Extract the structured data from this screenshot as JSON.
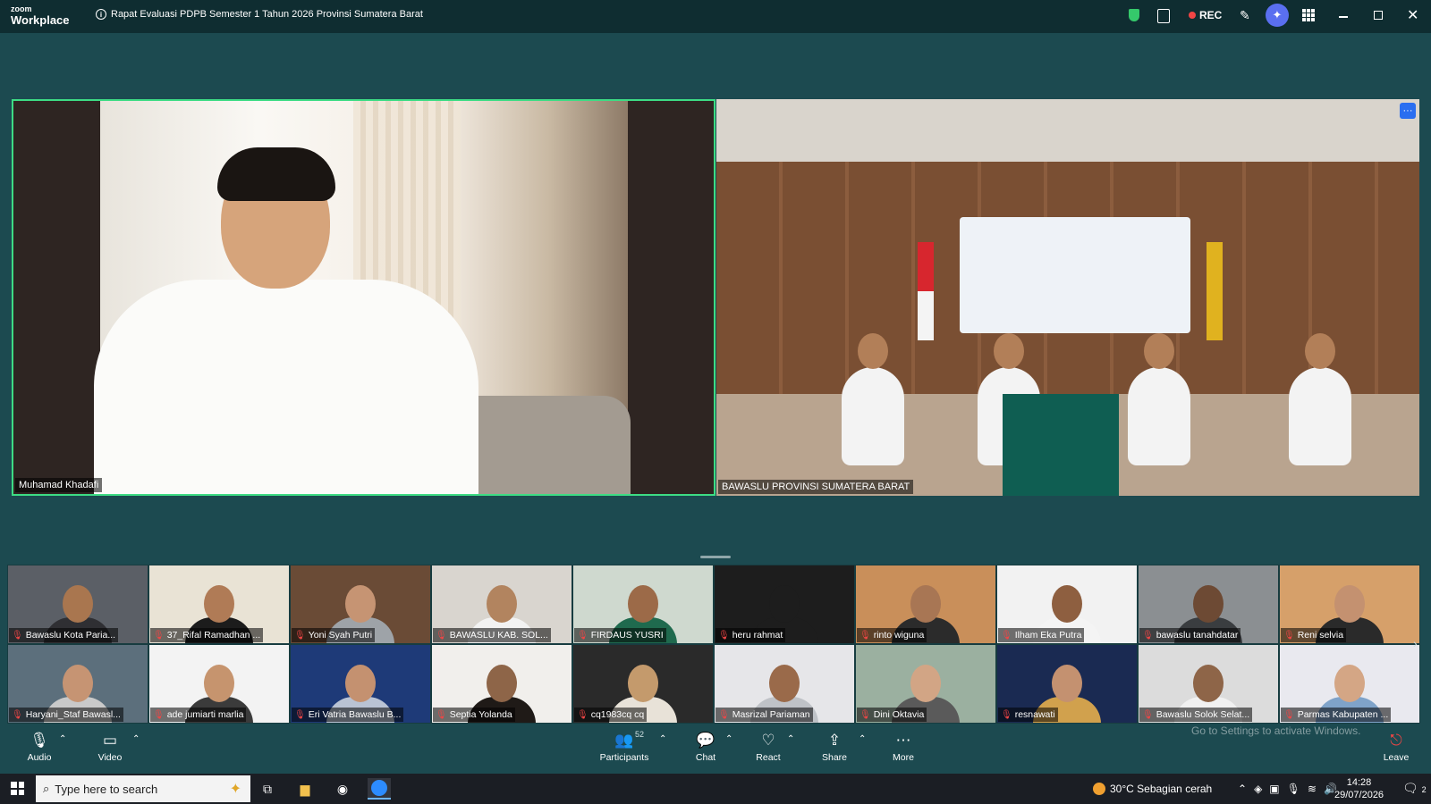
{
  "app": {
    "logo_line1": "zoom",
    "logo_line2": "Workplace",
    "meeting_title": "Rapat Evaluasi PDPB Semester 1 Tahun 2026 Provinsi Sumatera Barat",
    "rec_label": "REC",
    "accent_color": "#3ddc84",
    "rec_color": "#f04545"
  },
  "main_videos": [
    {
      "name": "Muhamad Khadafi",
      "active_speaker": true
    },
    {
      "name": "BAWASLU PROVINSI SUMATERA BARAT",
      "active_speaker": false
    }
  ],
  "gallery": [
    {
      "name": "Bawaslu Kota Paria...",
      "muted": false,
      "bg": "#5b5f66",
      "skin": "#a9764f",
      "cloth": "#2f2f33"
    },
    {
      "name": "37_Rifal Ramadhan ...",
      "muted": true,
      "bg": "#e9e3d5",
      "skin": "#b07b56",
      "cloth": "#1c1c1c"
    },
    {
      "name": "Yoni Syah Putri",
      "muted": true,
      "bg": "#6a4b36",
      "skin": "#c69473",
      "cloth": "#9ea3a8"
    },
    {
      "name": "BAWASLU KAB. SOL...",
      "muted": true,
      "bg": "#d9d5cf",
      "skin": "#b2845f",
      "cloth": "#f2f2f2"
    },
    {
      "name": "FIRDAUS YUSRI",
      "muted": true,
      "bg": "#cfd9cf",
      "skin": "#9c6a48",
      "cloth": "#1f6a4e"
    },
    {
      "name": "heru rahmat",
      "muted": true,
      "bg": "#1d1d1d",
      "skin": "#1d1d1d",
      "cloth": "#1d1d1d"
    },
    {
      "name": "rinto wiguna",
      "muted": true,
      "bg": "#c98f5a",
      "skin": "#a87654",
      "cloth": "#2b2b2b"
    },
    {
      "name": "Ilham Eka Putra",
      "muted": true,
      "bg": "#f2f2f2",
      "skin": "#8e5f40",
      "cloth": "#f4f4f4"
    },
    {
      "name": "bawaslu tanahdatar",
      "muted": true,
      "bg": "#8b8f92",
      "skin": "#6d4a34",
      "cloth": "#3a3d40"
    },
    {
      "name": "Reni selvia",
      "muted": true,
      "bg": "#d6a06a",
      "skin": "#c49170",
      "cloth": "#2a2a2a"
    },
    {
      "name": "Haryani_Staf Bawasl...",
      "muted": true,
      "bg": "#5c6f7c",
      "skin": "#c69473",
      "cloth": "#c9c9c9"
    },
    {
      "name": "ade jumiarti marlia",
      "muted": true,
      "bg": "#f3f3f3",
      "skin": "#c6946e",
      "cloth": "#3b3b3b"
    },
    {
      "name": "Eri Vatria Bawaslu B...",
      "muted": true,
      "bg": "#1e3a78",
      "skin": "#c49170",
      "cloth": "#b9c3d4"
    },
    {
      "name": "Septia Yolanda",
      "muted": true,
      "bg": "#f1efec",
      "skin": "#8e6548",
      "cloth": "#1f1a17"
    },
    {
      "name": "cq1983cq cq",
      "muted": true,
      "bg": "#2a2a2a",
      "skin": "#c49a6c",
      "cloth": "#e8e2d8"
    },
    {
      "name": "Masrizal Pariaman",
      "muted": true,
      "bg": "#e6e6e9",
      "skin": "#9a6a4a",
      "cloth": "#bfc2c7"
    },
    {
      "name": "Dini Oktavia",
      "muted": true,
      "bg": "#9bb0a0",
      "skin": "#d2a585",
      "cloth": "#5a5a5a"
    },
    {
      "name": "resnawati",
      "muted": true,
      "bg": "#1a2a52",
      "skin": "#c49170",
      "cloth": "#d1a14d"
    },
    {
      "name": "Bawaslu Solok Selat...",
      "muted": true,
      "bg": "#dcdcdc",
      "skin": "#8e6548",
      "cloth": "#f1f1f1"
    },
    {
      "name": "Parmas Kabupaten ...",
      "muted": true,
      "bg": "#e9e9ef",
      "skin": "#d4a685",
      "cloth": "#7fa3c9"
    }
  ],
  "watermark": "Go to Settings to activate Windows.",
  "toolbar": {
    "audio": "Audio",
    "video": "Video",
    "participants": "Participants",
    "participants_count": "52",
    "chat": "Chat",
    "react": "React",
    "share": "Share",
    "more": "More",
    "leave": "Leave"
  },
  "taskbar": {
    "search_placeholder": "Type here to search",
    "weather": "30°C  Sebagian cerah",
    "time": "14:28",
    "date": "29/07/2026",
    "notifications": "2"
  }
}
